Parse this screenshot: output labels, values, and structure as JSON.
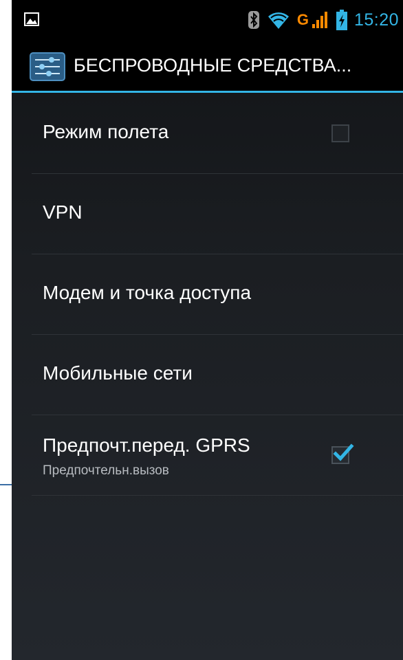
{
  "status_bar": {
    "notification_icon": "image-notification-icon",
    "bluetooth_icon": "bluetooth-icon",
    "wifi_icon": "wifi-icon",
    "network_type": "G",
    "signal_icon": "signal-icon",
    "battery_icon": "battery-charging-icon",
    "time": "15:20",
    "time_color": "#33b5e5",
    "network_color": "#ff8a00"
  },
  "action_bar": {
    "icon": "settings-sliders-icon",
    "title": "БЕСПРОВОДНЫЕ СРЕДСТВА...",
    "accent": "#33b5e5"
  },
  "settings": {
    "items": [
      {
        "label": "Режим полета",
        "checkbox": false
      },
      {
        "label": "VPN"
      },
      {
        "label": "Модем и точка доступа"
      },
      {
        "label": "Мобильные сети"
      },
      {
        "label": "Предпочт.перед. GPRS",
        "summary": "Предпочтельн.вызов",
        "checkbox": true
      }
    ]
  }
}
